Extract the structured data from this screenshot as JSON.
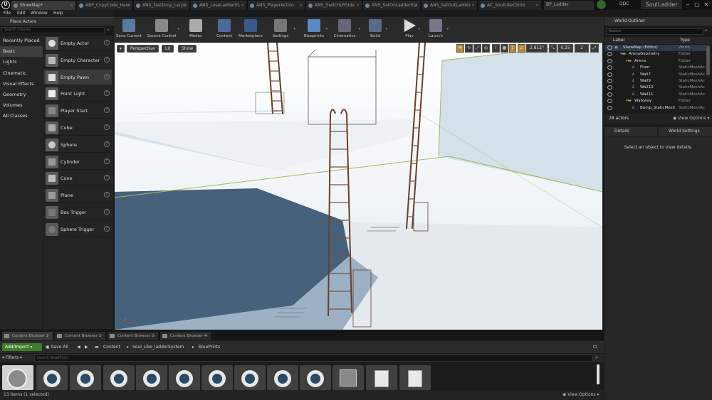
{
  "tabs": [
    {
      "label": "ShowMap*",
      "active": true
    },
    {
      "label": "ABP_CopyCode_Hero"
    },
    {
      "label": "ANS_FastDrop_LerpL"
    },
    {
      "label": "ANS_LoseLadder01"
    },
    {
      "label": "ANS_PlayerAction"
    },
    {
      "label": "ANS_SwitchLRSide"
    },
    {
      "label": "ANS_SetOnLadderSta"
    },
    {
      "label": "ANS_SetOutLadder"
    },
    {
      "label": "AC_SoulLikeClimb"
    }
  ],
  "blueprint_tab": "BP_Ladder",
  "ddc_label": "DDC",
  "project_name": "SoulLadder",
  "menu": [
    "File",
    "Edit",
    "Window",
    "Help"
  ],
  "place_actors": {
    "title": "Place Actors",
    "search_placeholder": "Search Classes",
    "categories": [
      "Recently Placed",
      "Basic",
      "Lights",
      "Cinematic",
      "Visual Effects",
      "Geometry",
      "Volumes",
      "All Classes"
    ],
    "selected_category": "Basic",
    "items": [
      {
        "label": "Empty Actor",
        "icon": "empty-actor-icon"
      },
      {
        "label": "Empty Character",
        "icon": "character-icon"
      },
      {
        "label": "Empty Pawn",
        "icon": "pawn-icon"
      },
      {
        "label": "Point Light",
        "icon": "light-bulb-icon"
      },
      {
        "label": "Player Start",
        "icon": "player-start-icon"
      },
      {
        "label": "Cube",
        "icon": "cube-icon"
      },
      {
        "label": "Sphere",
        "icon": "sphere-icon"
      },
      {
        "label": "Cylinder",
        "icon": "cylinder-icon"
      },
      {
        "label": "Cone",
        "icon": "cone-icon"
      },
      {
        "label": "Plane",
        "icon": "plane-icon"
      },
      {
        "label": "Box Trigger",
        "icon": "box-trigger-icon"
      },
      {
        "label": "Sphere Trigger",
        "icon": "sphere-trigger-icon"
      }
    ],
    "help_glyph": "?"
  },
  "toolbar": [
    {
      "label": "Save Current",
      "icon": "save-icon"
    },
    {
      "label": "Source Control",
      "icon": "source-control-icon"
    },
    {
      "label": "Modes",
      "icon": "modes-icon"
    },
    {
      "label": "Content",
      "icon": "content-icon"
    },
    {
      "label": "Marketplace",
      "icon": "marketplace-icon"
    },
    {
      "label": "Settings",
      "icon": "settings-icon"
    },
    {
      "label": "Blueprints",
      "icon": "blueprints-icon"
    },
    {
      "label": "Cinematics",
      "icon": "cinematics-icon"
    },
    {
      "label": "Build",
      "icon": "build-icon"
    },
    {
      "label": "Play",
      "icon": "play-icon"
    },
    {
      "label": "Launch",
      "icon": "launch-icon"
    }
  ],
  "viewport": {
    "perspective": "Perspective",
    "lit": "Lit",
    "show": "Show",
    "grid_snap": "1",
    "angle_snap": "2.812°",
    "scale_snap": "0.25",
    "camera_speed": "2"
  },
  "content_browser": {
    "tabs": [
      "Content Browser 1",
      "Content Browser 2",
      "Content Browser 3",
      "Content Browser 4"
    ],
    "active_tab": "Content Browser 1",
    "add_import": "Add/Import",
    "save_all": "Save All",
    "breadcrumb": [
      "Content",
      "Soul_Like_ladderSystem",
      "BluePrints"
    ],
    "filters": "Filters",
    "search_placeholder": "Search BluePrints",
    "status": "13 items (1 selected)",
    "view_options": "View Options"
  },
  "outliner": {
    "title": "World Outliner",
    "search_placeholder": "Search",
    "col_label": "Label",
    "col_type": "Type",
    "rows": [
      {
        "label": "ShowMap (Editor)",
        "type": "World",
        "indent": 0,
        "icon": "world-icon"
      },
      {
        "label": "ArenaGeometry",
        "type": "Folder",
        "indent": 1,
        "icon": "folder-icon"
      },
      {
        "label": "Arena",
        "type": "Folder",
        "indent": 2,
        "icon": "folder-icon"
      },
      {
        "label": "Floor",
        "type": "StaticMeshAc",
        "indent": 3,
        "icon": "mesh-icon"
      },
      {
        "label": "Wall7",
        "type": "StaticMeshAc",
        "indent": 3,
        "icon": "mesh-icon"
      },
      {
        "label": "Wall9",
        "type": "StaticMeshAc",
        "indent": 3,
        "icon": "mesh-icon"
      },
      {
        "label": "Wall10",
        "type": "StaticMeshAc",
        "indent": 3,
        "icon": "mesh-icon"
      },
      {
        "label": "Wall11",
        "type": "StaticMeshAc",
        "indent": 3,
        "icon": "mesh-icon"
      },
      {
        "label": "Walkway",
        "type": "Folder",
        "indent": 2,
        "icon": "folder-icon"
      },
      {
        "label": "Bump_StaticMesh",
        "type": "StaticMeshAc",
        "indent": 3,
        "icon": "mesh-icon"
      }
    ],
    "actor_count": "28 actors",
    "view_options": "View Options"
  },
  "details": {
    "tab": "Details",
    "world_settings_tab": "World Settings",
    "empty_message": "Select an object to view details."
  }
}
